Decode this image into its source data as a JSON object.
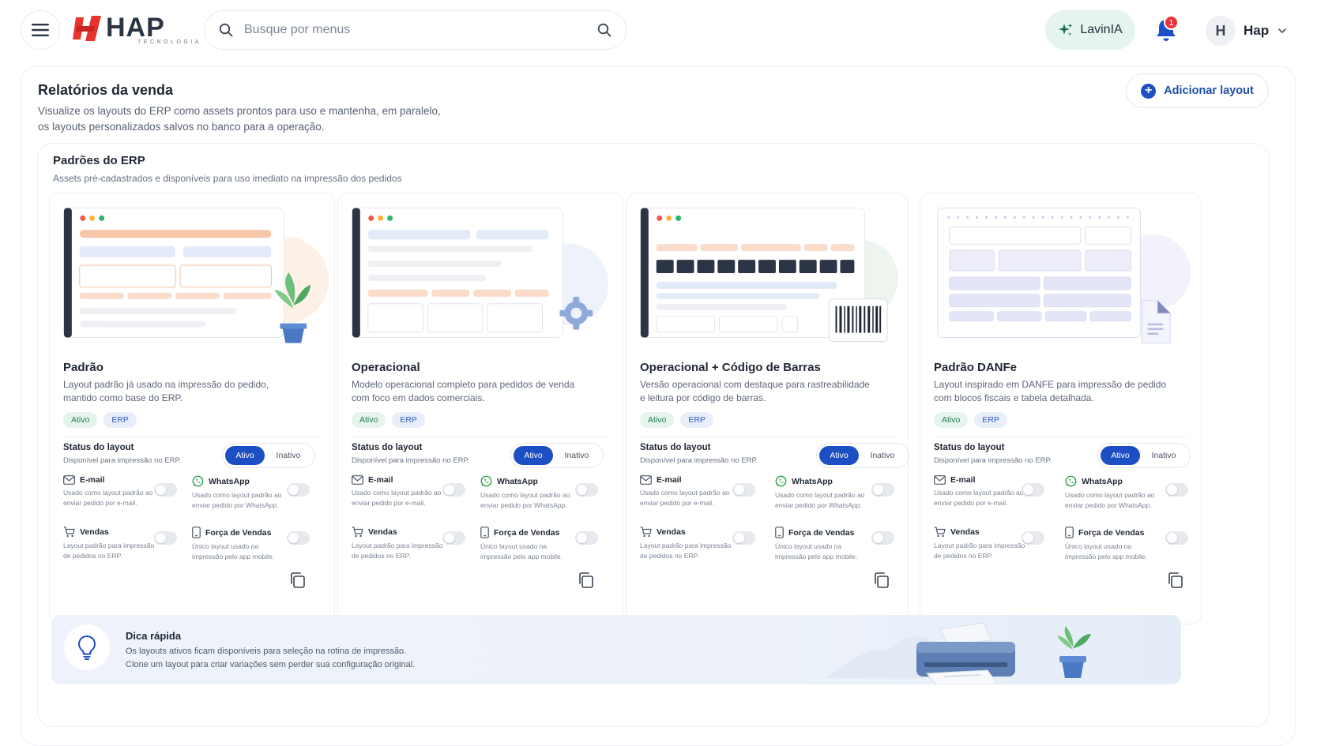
{
  "header": {
    "logo_text": "HAP",
    "logo_subtext": "TECNOLOGIA",
    "search_placeholder": "Busque por menus",
    "ai_button_label": "LavinIA",
    "notification_count": "1",
    "user_initial": "H",
    "user_name": "Hap"
  },
  "page": {
    "title": "Relatórios da venda",
    "description_line1": "Visualize os layouts do ERP como assets prontos para uso e mantenha, em paralelo,",
    "description_line2": "os layouts personalizados salvos no banco para a operação.",
    "add_button_label": "Adicionar layout"
  },
  "section": {
    "title": "Padrões do ERP",
    "description": "Assets pré-cadastrados e disponíveis para uso imediato na impressão dos pedidos"
  },
  "cards": [
    {
      "title": "Padrão",
      "description": "Layout padrão já usado na impressão do pedido, mantido como base do ERP.",
      "tag_status": "Ativo",
      "tag_source": "ERP",
      "status_title": "Status do layout",
      "status_desc": "Disponível para impressão no ERP.",
      "status_on": "Ativo",
      "status_off": "Inativo",
      "options": [
        {
          "label": "E-mail",
          "desc": "Usado como layout padrão ao enviar pedido por e-mail.",
          "icon": "mail-icon",
          "enabled": false
        },
        {
          "label": "WhatsApp",
          "desc": "Usado como layout padrão ao enviar pedido por WhatsApp.",
          "icon": "whatsapp-icon",
          "enabled": false
        },
        {
          "label": "Vendas",
          "desc": "Layout padrão para impressão de pedidos no ERP.",
          "icon": "cart-icon",
          "enabled": false
        },
        {
          "label": "Força de Vendas",
          "desc": "Único layout usado na impressão pelo app mobile.",
          "icon": "mobile-icon",
          "enabled": false
        }
      ]
    },
    {
      "title": "Operacional",
      "description": "Modelo operacional completo para pedidos de venda com foco em dados comerciais.",
      "tag_status": "Ativo",
      "tag_source": "ERP",
      "status_title": "Status do layout",
      "status_desc": "Disponível para impressão no ERP.",
      "status_on": "Ativo",
      "status_off": "Inativo",
      "options": [
        {
          "label": "E-mail",
          "desc": "Usado como layout padrão ao enviar pedido por e-mail.",
          "icon": "mail-icon",
          "enabled": false
        },
        {
          "label": "WhatsApp",
          "desc": "Usado como layout padrão ao enviar pedido por WhatsApp.",
          "icon": "whatsapp-icon",
          "enabled": false
        },
        {
          "label": "Vendas",
          "desc": "Layout padrão para impressão de pedidos no ERP.",
          "icon": "cart-icon",
          "enabled": false
        },
        {
          "label": "Força de Vendas",
          "desc": "Único layout usado na impressão pelo app mobile.",
          "icon": "mobile-icon",
          "enabled": false
        }
      ]
    },
    {
      "title": "Operacional + Código de Barras",
      "description": "Versão operacional com destaque para rastreabilidade e leitura por código de barras.",
      "tag_status": "Ativo",
      "tag_source": "ERP",
      "status_title": "Status do layout",
      "status_desc": "Disponível para impressão no ERP.",
      "status_on": "Ativo",
      "status_off": "Inativo",
      "options": [
        {
          "label": "E-mail",
          "desc": "Usado como layout padrão ao enviar pedido por e-mail.",
          "icon": "mail-icon",
          "enabled": false
        },
        {
          "label": "WhatsApp",
          "desc": "Usado como layout padrão ao enviar pedido por WhatsApp.",
          "icon": "whatsapp-icon",
          "enabled": false
        },
        {
          "label": "Vendas",
          "desc": "Layout padrão para impressão de pedidos no ERP.",
          "icon": "cart-icon",
          "enabled": false
        },
        {
          "label": "Força de Vendas",
          "desc": "Único layout usado na impressão pelo app mobile.",
          "icon": "mobile-icon",
          "enabled": false
        }
      ]
    },
    {
      "title": "Padrão DANFe",
      "description": "Layout inspirado em DANFE para impressão de pedido com blocos fiscais e tabela detalhada.",
      "tag_status": "Ativo",
      "tag_source": "ERP",
      "status_title": "Status do layout",
      "status_desc": "Disponível para impressão no ERP.",
      "status_on": "Ativo",
      "status_off": "Inativo",
      "options": [
        {
          "label": "E-mail",
          "desc": "Usado como layout padrão ao enviar pedido por e-mail.",
          "icon": "mail-icon",
          "enabled": false
        },
        {
          "label": "WhatsApp",
          "desc": "Usado como layout padrão ao enviar pedido por WhatsApp.",
          "icon": "whatsapp-icon",
          "enabled": false
        },
        {
          "label": "Vendas",
          "desc": "Layout padrão para impressão de pedidos no ERP.",
          "icon": "cart-icon",
          "enabled": false
        },
        {
          "label": "Força de Vendas",
          "desc": "Único layout usado na impressão pelo app mobile.",
          "icon": "mobile-icon",
          "enabled": false
        }
      ]
    }
  ],
  "tip": {
    "title": "Dica rápida",
    "line1": "Os layouts ativos ficam disponíveis para seleção na rotina de impressão.",
    "line2": "Clone um layout para criar variações sem perder sua configuração original."
  },
  "colors": {
    "primary": "#1d4fc4",
    "logo_red": "#e8322c",
    "active_tag_bg": "#e6f4ee",
    "erp_tag_bg": "#e9effa",
    "badge_red": "#e8323a"
  }
}
